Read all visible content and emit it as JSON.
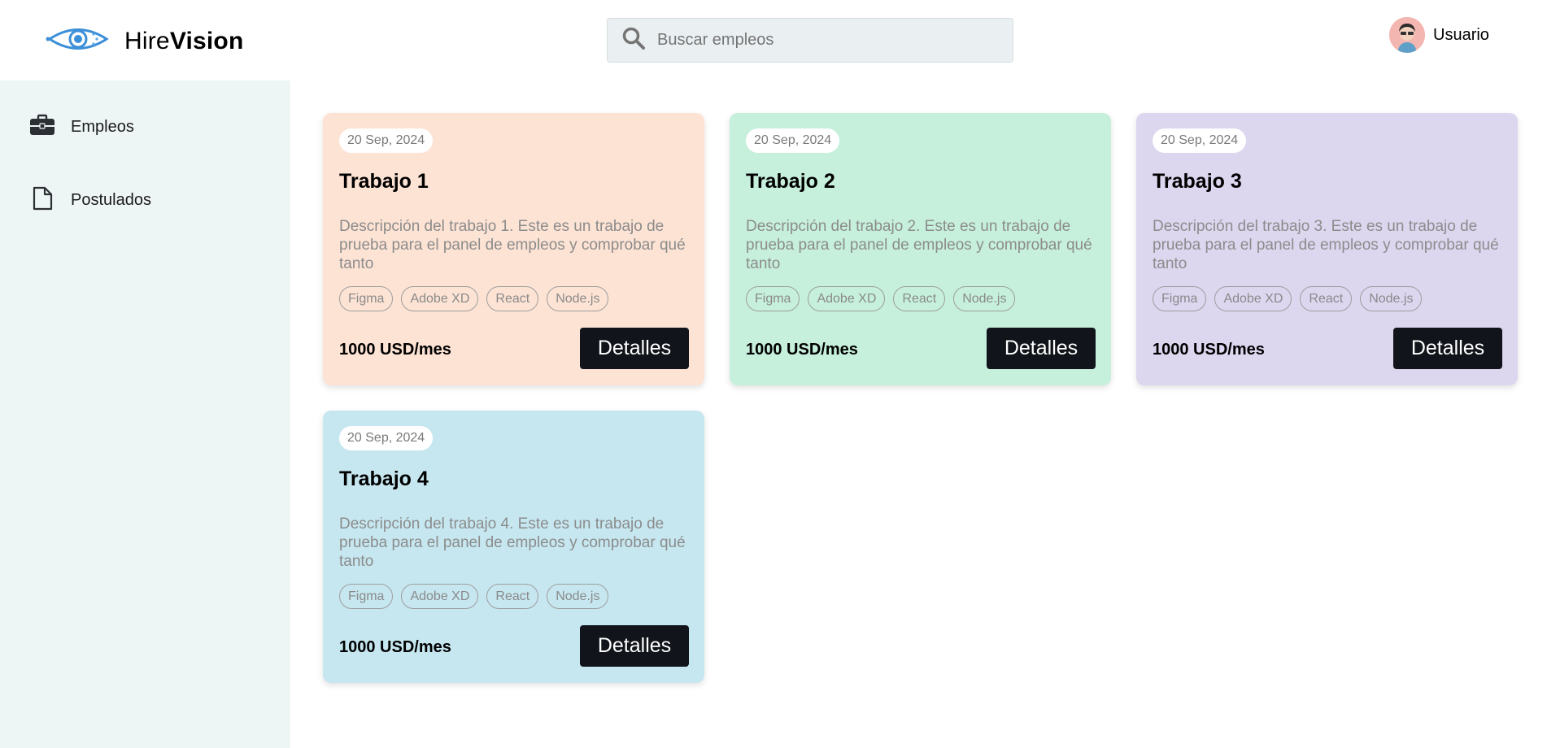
{
  "header": {
    "brand_light": "Hire",
    "brand_bold": "Vision",
    "search_placeholder": "Buscar empleos",
    "user_name": "Usuario"
  },
  "sidebar": {
    "items": [
      {
        "label": "Empleos",
        "icon": "briefcase-icon"
      },
      {
        "label": "Postulados",
        "icon": "file-icon"
      }
    ]
  },
  "colors": {
    "card1": "#fde3d4",
    "card2": "#c6f0dc",
    "card3": "#dcd6ef",
    "card4": "#c6e7f0",
    "sidebar": "#eef6f5",
    "button": "#11141a",
    "logo": "#3b8fd8"
  },
  "jobs": [
    {
      "date": "20 Sep, 2024",
      "title": "Trabajo 1",
      "description": "Descripción del trabajo 1. Este es un trabajo de prueba para el panel de empleos y comprobar qué tanto",
      "tags": [
        "Figma",
        "Adobe XD",
        "React",
        "Node.js"
      ],
      "salary": "1000 USD/mes",
      "button": "Detalles"
    },
    {
      "date": "20 Sep, 2024",
      "title": "Trabajo 2",
      "description": "Descripción del trabajo 2. Este es un trabajo de prueba para el panel de empleos y comprobar qué tanto",
      "tags": [
        "Figma",
        "Adobe XD",
        "React",
        "Node.js"
      ],
      "salary": "1000 USD/mes",
      "button": "Detalles"
    },
    {
      "date": "20 Sep, 2024",
      "title": "Trabajo 3",
      "description": "Descripción del trabajo 3. Este es un trabajo de prueba para el panel de empleos y comprobar qué tanto",
      "tags": [
        "Figma",
        "Adobe XD",
        "React",
        "Node.js"
      ],
      "salary": "1000 USD/mes",
      "button": "Detalles"
    },
    {
      "date": "20 Sep, 2024",
      "title": "Trabajo 4",
      "description": "Descripción del trabajo 4. Este es un trabajo de prueba para el panel de empleos y comprobar qué tanto",
      "tags": [
        "Figma",
        "Adobe XD",
        "React",
        "Node.js"
      ],
      "salary": "1000 USD/mes",
      "button": "Detalles"
    }
  ]
}
